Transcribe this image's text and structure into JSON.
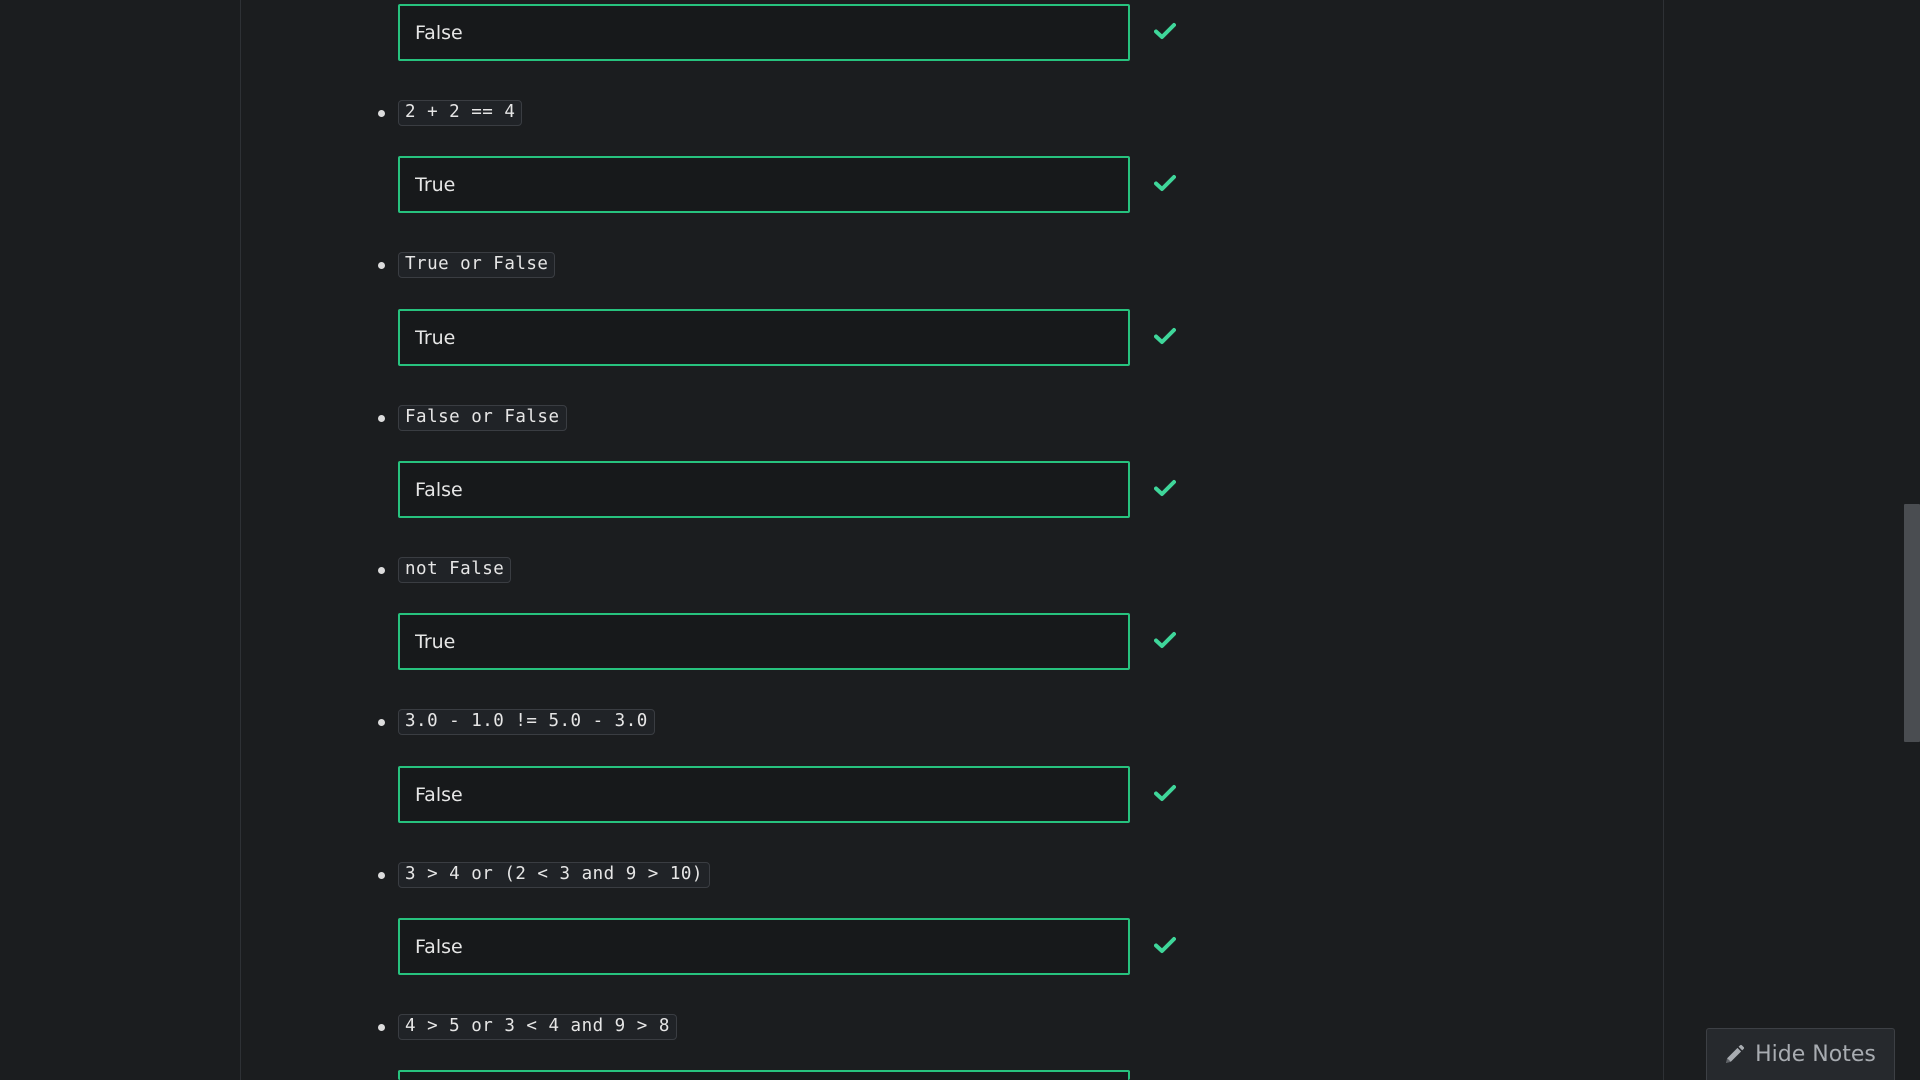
{
  "exercises": [
    {
      "expression": "",
      "answer": "False",
      "status": "correct"
    },
    {
      "expression": "2 + 2 == 4",
      "answer": "True",
      "status": "correct"
    },
    {
      "expression": "True or False",
      "answer": "True",
      "status": "correct"
    },
    {
      "expression": "False or False",
      "answer": "False",
      "status": "correct"
    },
    {
      "expression": "not False",
      "answer": "True",
      "status": "correct"
    },
    {
      "expression": "3.0 - 1.0 != 5.0 - 3.0",
      "answer": "False",
      "status": "correct"
    },
    {
      "expression": "3 > 4 or (2 < 3 and 9 > 10)",
      "answer": "False",
      "status": "correct"
    },
    {
      "expression": "4 > 5 or 3 < 4 and 9 > 8",
      "answer": "",
      "status": ""
    }
  ],
  "notes_button": {
    "label": "Hide Notes",
    "icon": "pencil-icon"
  },
  "colors": {
    "accent_green": "#27c27e",
    "check_green": "#3fd69a",
    "background": "#1b1d1f"
  }
}
